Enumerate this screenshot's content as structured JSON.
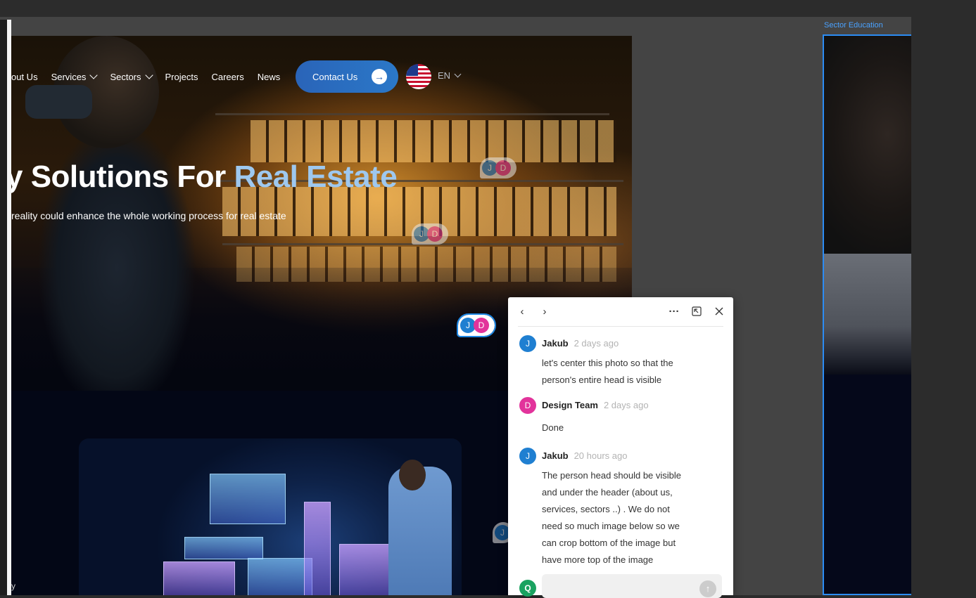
{
  "nav": {
    "items": [
      {
        "label": "out Us",
        "dropdown": false
      },
      {
        "label": "Services",
        "dropdown": true
      },
      {
        "label": "Sectors",
        "dropdown": true
      },
      {
        "label": "Projects",
        "dropdown": false
      },
      {
        "label": "Careers",
        "dropdown": false
      },
      {
        "label": "News",
        "dropdown": false
      }
    ],
    "contact_label": "Contact Us",
    "contact_icon": "arrow-right-icon",
    "flag_icon": "us-flag-icon",
    "lang": "EN"
  },
  "hero": {
    "title_prefix": "y Solutions For ",
    "title_accent": "Real Estate",
    "subtitle": "reality could enhance the whole working process for real estate"
  },
  "bottom_text": "y",
  "frame_label": "Sector Education",
  "markers": [
    {
      "a": "J",
      "b": "D"
    },
    {
      "a": "J",
      "b": "D"
    },
    {
      "a": "J",
      "b": "D"
    },
    {
      "a": "J"
    }
  ],
  "thread": {
    "comments": [
      {
        "initial": "J",
        "name": "Jakub",
        "time": "2 days ago",
        "color": "#1f7fd1",
        "lines": [
          "let's center this photo so that the",
          "person's entire head is visible"
        ]
      },
      {
        "initial": "D",
        "name": "Design Team",
        "time": "2 days ago",
        "color": "#e2339b",
        "lines": [
          "Done"
        ]
      },
      {
        "initial": "J",
        "name": "Jakub",
        "time": "20 hours ago",
        "color": "#1f7fd1",
        "lines": [
          "The person head should be visible",
          "and under the header (about us,",
          "services, sectors ..) . We do not",
          "need so much image below so we",
          "can crop bottom of the image but",
          "have more top of the image"
        ]
      }
    ],
    "reply_avatar": "Q",
    "reply_avatar_color": "#1aa260"
  },
  "colors": {
    "accent": "#2c8cf4",
    "title_accent": "#9ec8ef",
    "button": "#2a64b8"
  }
}
